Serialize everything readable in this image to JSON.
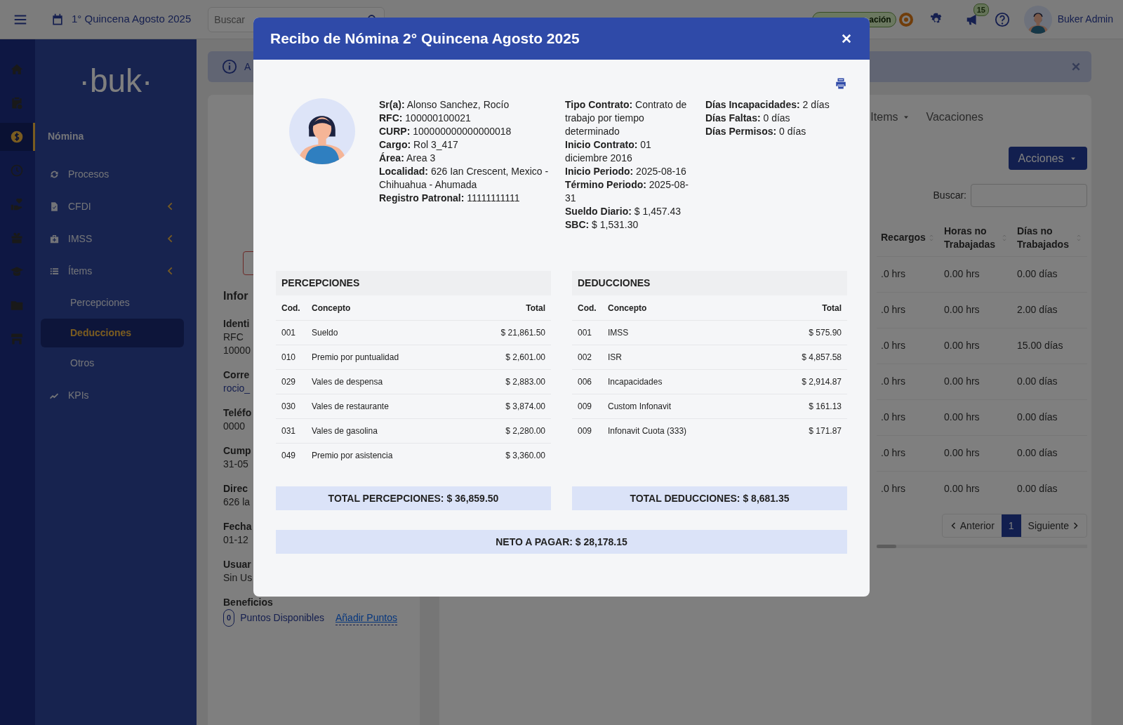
{
  "topbar": {
    "period": "1° Quincena Agosto 2025",
    "search": {
      "placeholder": "Buscar"
    },
    "role_badge": "ación",
    "notifications": "15",
    "user": "Buker Admin"
  },
  "rail": [
    {
      "kind": "home",
      "selected": false
    },
    {
      "kind": "clipboard",
      "selected": false
    },
    {
      "kind": "dollar",
      "selected": true
    },
    {
      "kind": "clock",
      "selected": false
    },
    {
      "kind": "hand-heart",
      "selected": false
    },
    {
      "kind": "gift",
      "selected": false
    },
    {
      "kind": "cap",
      "selected": false
    },
    {
      "kind": "folder",
      "selected": false
    },
    {
      "kind": "store",
      "selected": false
    }
  ],
  "sidebar": {
    "logo": "·buk·",
    "entries": [
      {
        "kind": "section",
        "label": "Nómina"
      },
      {
        "kind": "link",
        "label": "Procesos",
        "submenu": false
      },
      {
        "kind": "link",
        "label": "CFDI",
        "submenu": true
      },
      {
        "kind": "link",
        "label": "IMSS",
        "submenu": true
      },
      {
        "kind": "link",
        "label": "Ítems",
        "submenu": true
      },
      {
        "kind": "sub",
        "label": "Percepciones",
        "selected": false
      },
      {
        "kind": "sub",
        "label": "Deducciones",
        "selected": true
      },
      {
        "kind": "sub",
        "label": "Otros",
        "selected": false
      },
      {
        "kind": "link",
        "label": "KPIs",
        "submenu": false
      }
    ]
  },
  "alert": {
    "text": "A"
  },
  "profile_card": {
    "title": "Infor",
    "fields": [
      {
        "label": "Identi",
        "lines": [
          "RFC",
          "10000"
        ],
        "link": false
      },
      {
        "label": "Corre",
        "lines": [
          "rocio_"
        ],
        "link": true
      },
      {
        "label": "Teléfo",
        "lines": [
          "0000"
        ],
        "link": false
      },
      {
        "label": "Cump",
        "lines": [
          "31-05"
        ],
        "link": false
      },
      {
        "label": "Direc",
        "lines": [
          "626 la"
        ],
        "link": false
      },
      {
        "label": "Fecha",
        "lines": [
          "01-12"
        ],
        "link": false
      },
      {
        "label": "Usuar",
        "lines": [
          "Sin Us"
        ],
        "link": false
      }
    ],
    "benefits": {
      "label": "Beneficios",
      "points": "0",
      "points_label": "Puntos Disponibles",
      "action": "Añadir Puntos"
    }
  },
  "records": {
    "tabs": [
      {
        "label": "Items",
        "dropdown": true
      },
      {
        "label": "Vacaciones",
        "dropdown": false
      }
    ],
    "actions": "Acciones",
    "search_label": "Buscar:",
    "columns": [
      "Recargos",
      "Horas no Trabajadas",
      "Días no Trabajados"
    ],
    "rows": [
      [
        ".0 hrs",
        "0.00 hrs",
        "0.00 días"
      ],
      [
        ".0 hrs",
        "0.00 hrs",
        "2.00 días"
      ],
      [
        ".0 hrs",
        "0.00 hrs",
        "15.00 días"
      ],
      [
        ".0 hrs",
        "0.00 hrs",
        "0.00 días"
      ],
      [
        ".0 hrs",
        "0.00 hrs",
        "0.00 días"
      ],
      [
        ".0 hrs",
        "0.00 hrs",
        "0.00 días"
      ],
      [
        ".0 hrs",
        "0.00 hrs",
        "0.00 días"
      ]
    ],
    "pagination": {
      "prev": "Anterior",
      "pages": [
        {
          "label": "1",
          "selected": true
        }
      ],
      "next": "Siguiente"
    }
  },
  "modal": {
    "title": "Recibo de Nómina 2° Quincena Agosto 2025",
    "info": [
      [
        {
          "label": "Sr(a):",
          "value": "Alonso Sanchez, Rocío"
        },
        {
          "label": "RFC:",
          "value": "100000100021"
        },
        {
          "label": "CURP:",
          "value": "100000000000000018"
        },
        {
          "label": "Cargo:",
          "value": "Rol 3_417"
        },
        {
          "label": "Área:",
          "value": "Area 3"
        },
        {
          "label": "Localidad:",
          "value": "626 Ian Crescent, Mexico - Chihuahua - Ahumada"
        },
        {
          "label": "Registro Patronal:",
          "value": "11111111111"
        }
      ],
      [
        {
          "label": "Tipo Contrato:",
          "value": "Contrato de trabajo por tiempo determinado"
        },
        {
          "label": "Inicio Contrato:",
          "value": "01 diciembre 2016"
        },
        {
          "label": "Inicio Periodo:",
          "value": "2025-08-16"
        },
        {
          "label": "Término Periodo:",
          "value": "2025-08-31"
        },
        {
          "label": "Sueldo Diario:",
          "value": "$ 1,457.43"
        },
        {
          "label": "SBC:",
          "value": "$ 1,531.30"
        }
      ],
      [
        {
          "label": "Días Incapacidades:",
          "value": "2 días"
        },
        {
          "label": "Días Faltas:",
          "value": "0 días"
        },
        {
          "label": "Días Permisos:",
          "value": "0 días"
        }
      ]
    ],
    "tables": [
      {
        "title": "PERCEPCIONES",
        "columns": [
          "Cod.",
          "Concepto",
          "Total"
        ],
        "rows": [
          [
            "001",
            "Sueldo",
            "$ 21,861.50"
          ],
          [
            "010",
            "Premio por puntualidad",
            "$ 2,601.00"
          ],
          [
            "029",
            "Vales de despensa",
            "$ 2,883.00"
          ],
          [
            "030",
            "Vales de restaurante",
            "$ 3,874.00"
          ],
          [
            "031",
            "Vales de gasolina",
            "$ 2,280.00"
          ],
          [
            "049",
            "Premio por asistencia",
            "$ 3,360.00"
          ]
        ],
        "total": "TOTAL PERCEPCIONES: $ 36,859.50"
      },
      {
        "title": "DEDUCCIONES",
        "columns": [
          "Cod.",
          "Concepto",
          "Total"
        ],
        "rows": [
          [
            "001",
            "IMSS",
            "$ 575.90"
          ],
          [
            "002",
            "ISR",
            "$ 4,857.58"
          ],
          [
            "006",
            "Incapacidades",
            "$ 2,914.87"
          ],
          [
            "009",
            "Custom Infonavit",
            "$ 161.13"
          ],
          [
            "009",
            "Infonavit Cuota (333)",
            "$ 171.87"
          ]
        ],
        "total": "TOTAL DEDUCCIONES: $ 8,681.35"
      }
    ],
    "net": "NETO A PAGAR: $ 28,178.15"
  }
}
